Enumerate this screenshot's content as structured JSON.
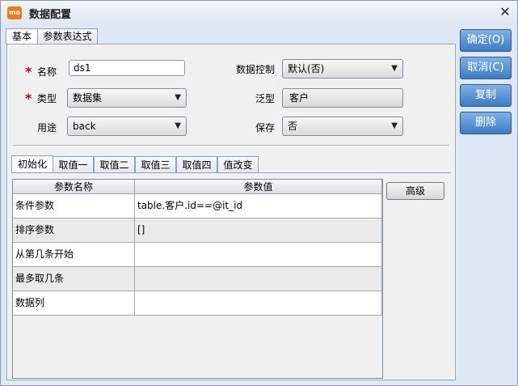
{
  "window": {
    "title": "数据配置",
    "close_glyph": "✕",
    "app_icon_text": "mo"
  },
  "main_tabs": [
    {
      "label": "基本"
    },
    {
      "label": "参数表达式"
    }
  ],
  "form": {
    "name": {
      "label": "名称",
      "value": "ds1",
      "required_mark": "*"
    },
    "type": {
      "label": "类型",
      "value": "数据集",
      "required_mark": "*"
    },
    "usage": {
      "label": "用途",
      "value": "back"
    },
    "data_control": {
      "label": "数据控制",
      "value": "默认(否)"
    },
    "generic": {
      "label": "泛型",
      "value": "客户"
    },
    "save": {
      "label": "保存",
      "value": "否"
    }
  },
  "sub_tabs": [
    {
      "label": "初始化"
    },
    {
      "label": "取值一"
    },
    {
      "label": "取值二"
    },
    {
      "label": "取值三"
    },
    {
      "label": "取值四"
    },
    {
      "label": "值改变"
    }
  ],
  "param_table": {
    "columns": [
      "参数名称",
      "参数值"
    ],
    "rows": [
      {
        "name": "条件参数",
        "value": "table.客户.id==@it_id"
      },
      {
        "name": "排序参数",
        "value": "[]"
      },
      {
        "name": "从第几条开始",
        "value": ""
      },
      {
        "name": "最多取几条",
        "value": ""
      },
      {
        "name": "数据列",
        "value": ""
      }
    ]
  },
  "advanced_button": {
    "label": "高级"
  },
  "side_buttons": {
    "ok": "确定(O)",
    "cancel": "取消(C)",
    "copy": "复制",
    "delete": "删除"
  },
  "icons": {
    "dropdown": "chevron-down-icon",
    "close": "close-icon",
    "app": "app-logo-icon"
  },
  "colors": {
    "side_button": "#3d7cc4",
    "required": "#d40000",
    "window_bg": "#dde8f4"
  }
}
